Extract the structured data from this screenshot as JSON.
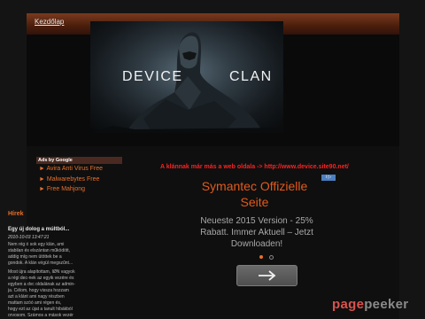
{
  "nav": {
    "home_label": "Kezdőlap"
  },
  "banner": {
    "left_word": "DEVICE",
    "right_word": "CLAN"
  },
  "sidebar": {
    "ads_label": "Ads by Google",
    "ad_links": [
      "► Avira Anti Virus Free",
      "► Malwarebytes Free",
      "► Free Mahjong"
    ],
    "section_title": "Hírek",
    "post": {
      "title": "Egy új dolog a múltból...",
      "date": "2010-10-03 13:47:21",
      "paragraph1": [
        "Nem rég ó sok egy klán, ami",
        "stabilan és elszántan működött,",
        "addig míg nem ütöttek be a",
        "gondok. A klán végül megszűnt..."
      ],
      "paragraph2": [
        "Most újra alapítottam, IØN vagyok",
        "a régi dec-nek az egyik vezére és",
        "egyben a dvc oldalának az admin-",
        "ja. Célom, hogy vissza hozzam",
        "azt a klánt ami nagy részben",
        "mattam szóó ami régen és,",
        "hogy ezt az újat a tanult hibákból",
        "orvosom. Számos a mások vezér"
      ]
    }
  },
  "main": {
    "announcement": "A klánnak már más a web oldala -> http://www.device.site90.net/",
    "ad_badge": "i ▷",
    "ad_headline": [
      "Symantec Offizielle",
      "Seite"
    ],
    "ad_body": [
      "Neueste 2015 Version - 25%",
      "Rabatt. Immer Aktuell – Jetzt",
      "Downloaden!"
    ],
    "carousel_pages": 2,
    "carousel_active_index": 0,
    "next_label": "→"
  },
  "watermark": {
    "part1": "page",
    "part2": "peeker"
  },
  "colors": {
    "accent_orange": "#e8702a",
    "announcement_red": "#ff2020",
    "watermark_red": "#d9534f",
    "watermark_grey": "#8a8a8a"
  }
}
